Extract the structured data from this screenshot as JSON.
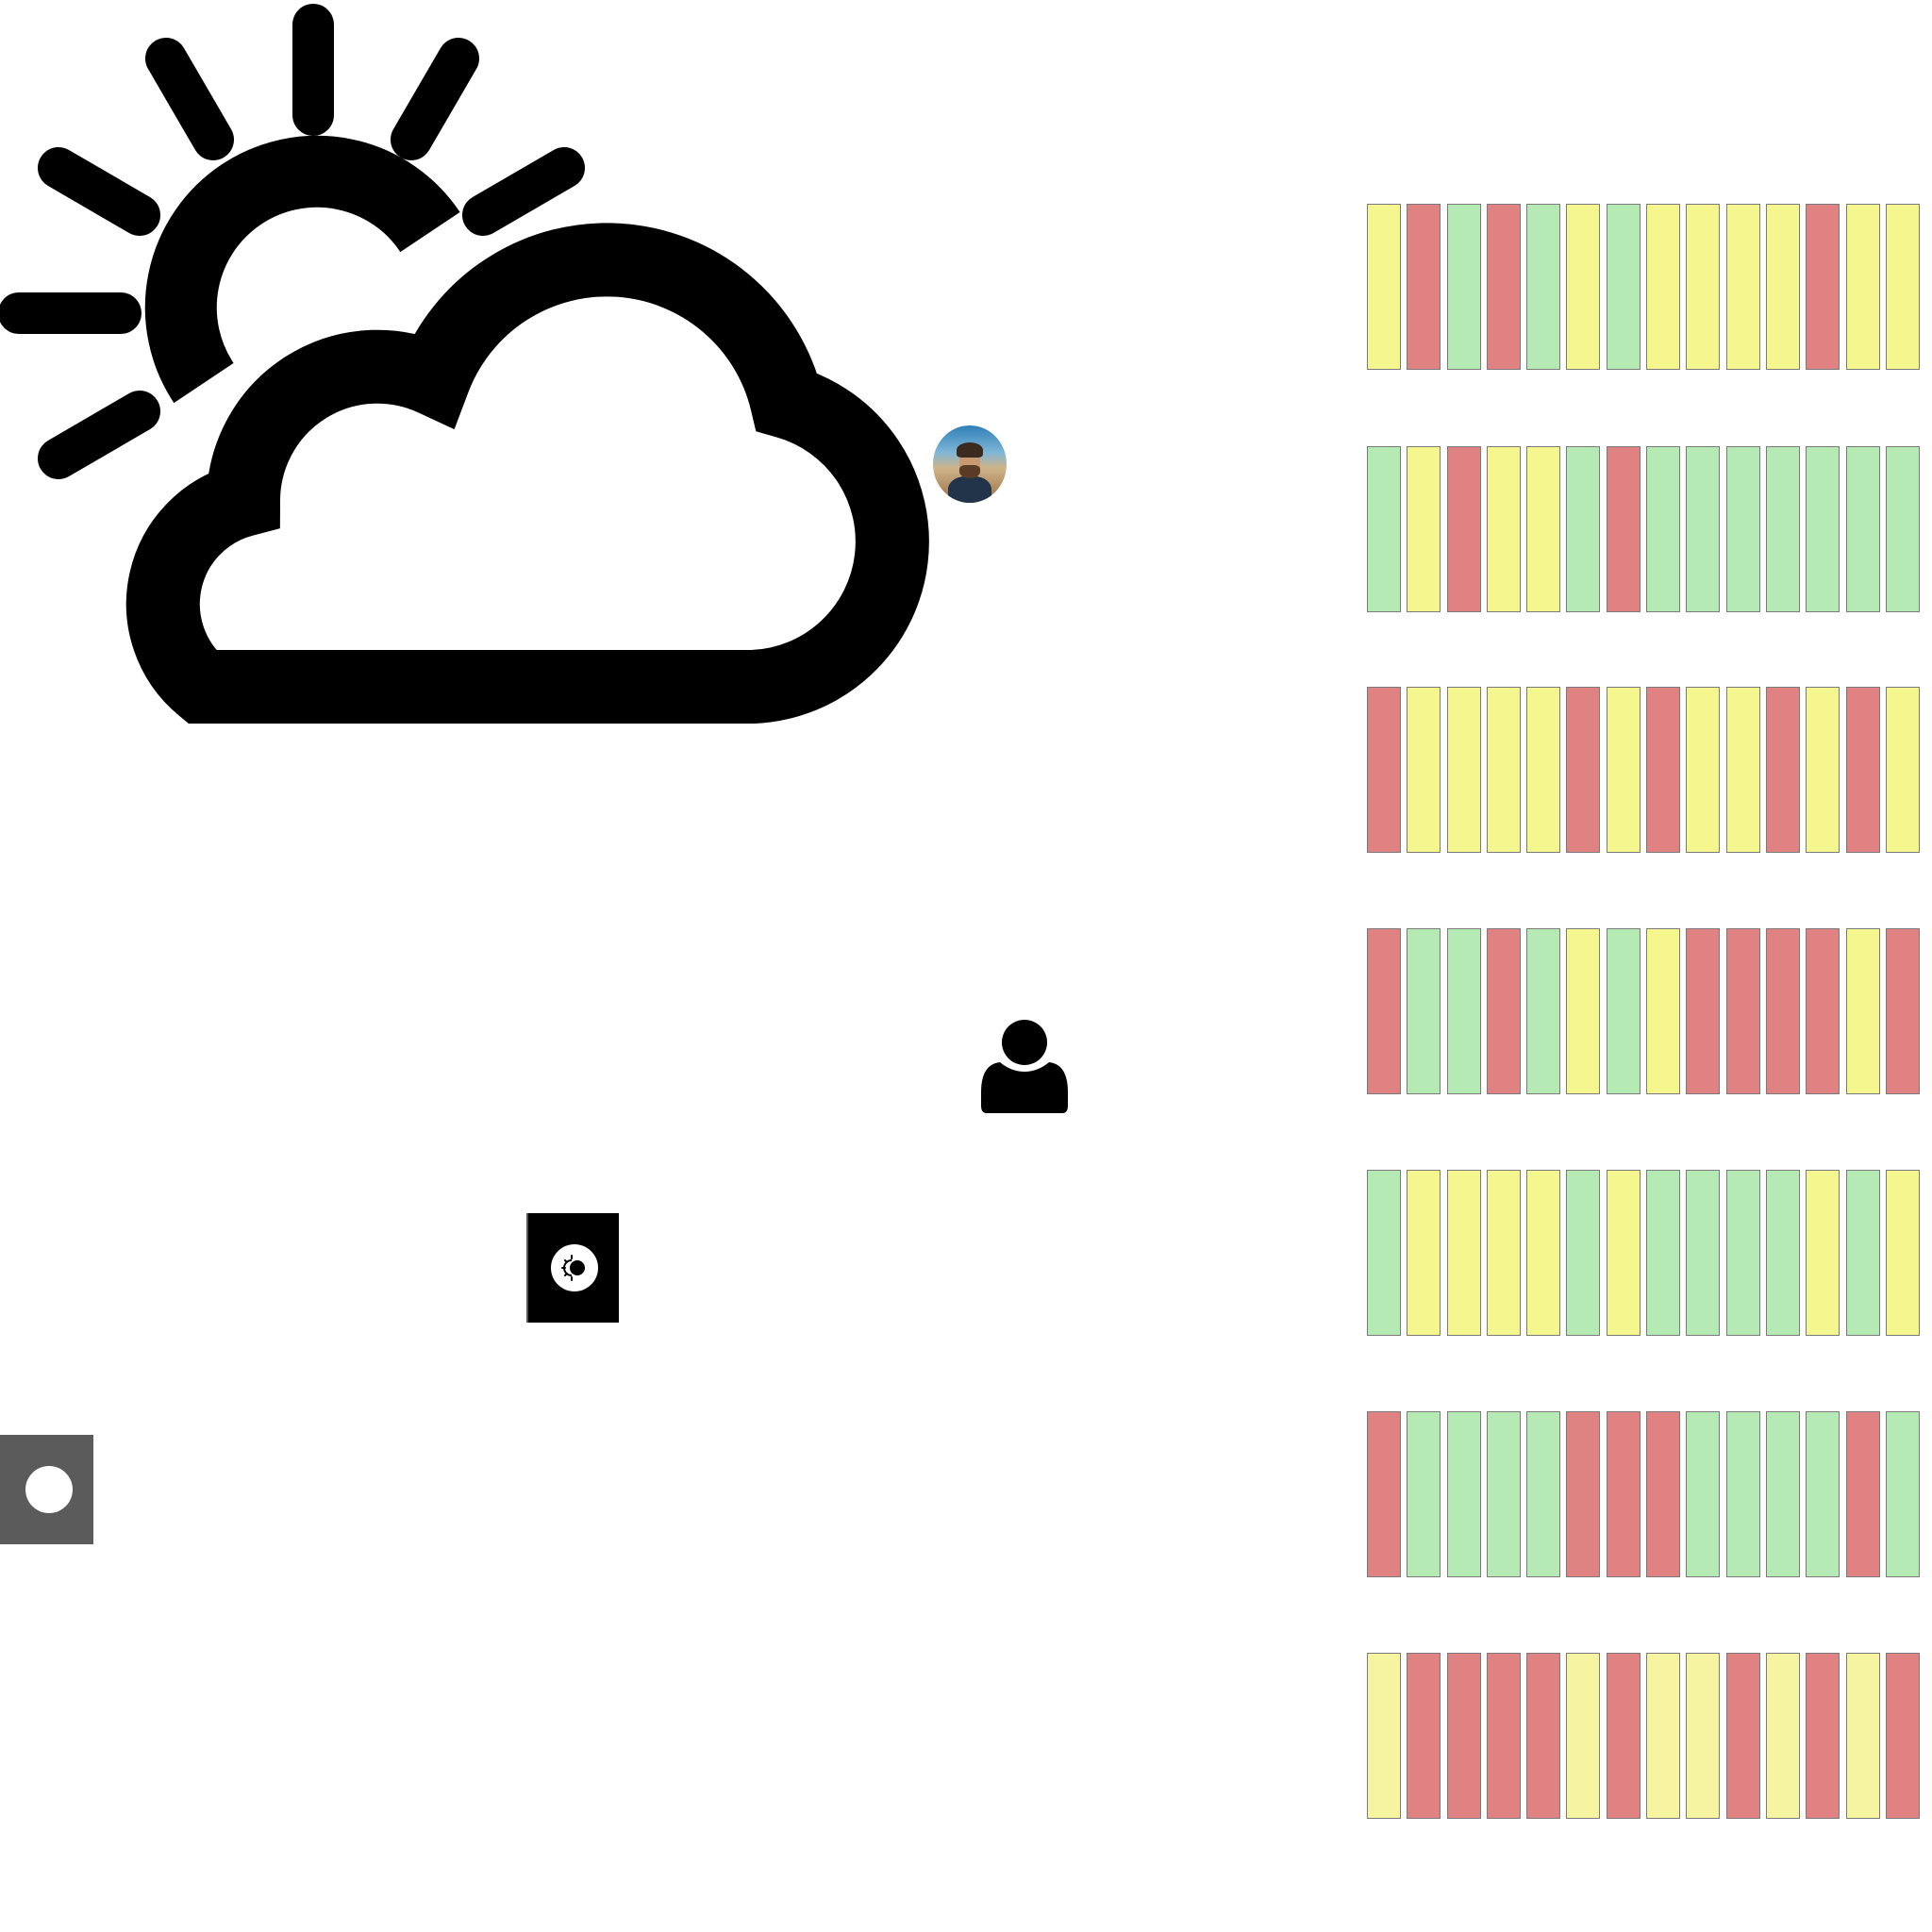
{
  "weather_icon": {
    "icon": "partly-cloudy-icon"
  },
  "avatar": {
    "icon": "user-photo"
  },
  "user_icon": {
    "icon": "user-icon"
  },
  "theme_toggle": {
    "icon": "light-mode-icon",
    "state": "dark"
  },
  "record_toggle": {
    "icon": "toggle-knob",
    "state": "off"
  },
  "colors": {
    "green": "#b6eab5",
    "yellow": "#f6f68e",
    "red": "#e08282",
    "border": "#7a7a7a"
  },
  "status_grid": {
    "rows": [
      [
        "yellow",
        "red",
        "green",
        "red",
        "green",
        "yellow",
        "green",
        "yellow",
        "yellow",
        "yellow",
        "yellow",
        "red",
        "yellow",
        "yellow"
      ],
      [
        "green",
        "yellow",
        "red",
        "yellow",
        "yellow",
        "green",
        "red",
        "green",
        "green",
        "green",
        "green",
        "green",
        "green",
        "green"
      ],
      [
        "red",
        "yellow",
        "yellow",
        "yellow",
        "yellow",
        "red",
        "yellow",
        "red",
        "yellow",
        "yellow",
        "red",
        "yellow",
        "red",
        "yellow"
      ],
      [
        "red",
        "green",
        "green",
        "red",
        "green",
        "yellow",
        "green",
        "yellow",
        "red",
        "red",
        "red",
        "red",
        "yellow",
        "red"
      ],
      [
        "green",
        "yellow",
        "yellow",
        "yellow",
        "yellow",
        "green",
        "yellow",
        "green",
        "green",
        "green",
        "green",
        "yellow",
        "green",
        "yellow"
      ],
      [
        "red",
        "green",
        "green",
        "green",
        "green",
        "red",
        "red",
        "red",
        "green",
        "green",
        "green",
        "green",
        "red",
        "green"
      ],
      [
        "yellow",
        "red",
        "red",
        "red",
        "red",
        "yellow",
        "red",
        "yellow",
        "yellow",
        "red",
        "yellow",
        "red",
        "yellow",
        "red"
      ]
    ]
  }
}
